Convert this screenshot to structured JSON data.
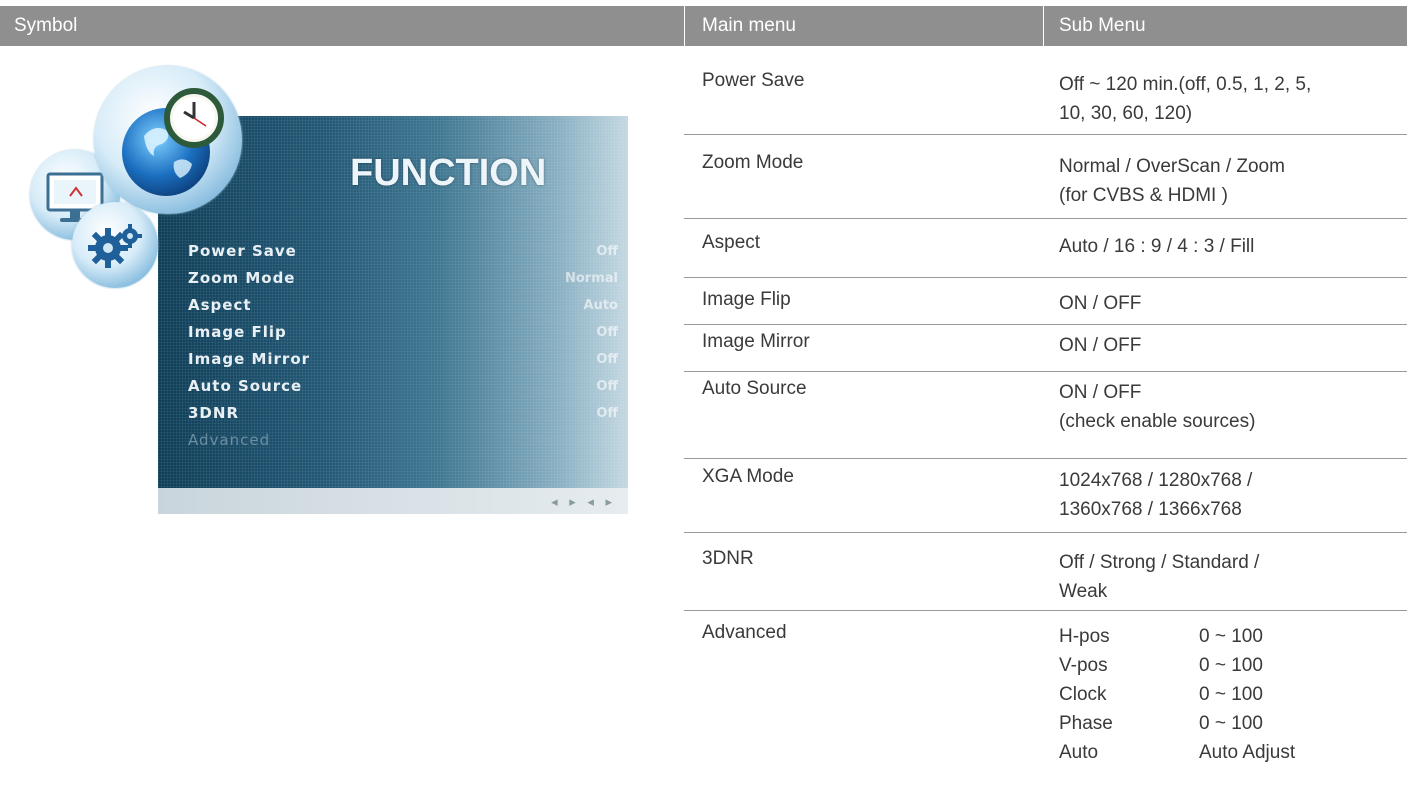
{
  "headers": {
    "symbol": "Symbol",
    "main_menu": "Main menu",
    "sub_menu": "Sub Menu"
  },
  "osd": {
    "title": "FUNCTION",
    "items": [
      "Power Save",
      "Zoom Mode",
      "Aspect",
      "Image Flip",
      "Image Mirror",
      "Auto Source",
      "3DNR",
      "Advanced"
    ],
    "values": [
      "Off",
      "Normal",
      "Auto",
      "Off",
      "Off",
      "Off",
      "Off"
    ]
  },
  "rows": [
    {
      "main": "Power Save",
      "sub": [
        "Off ~ 120 min.(off, 0.5, 1, 2, 5,",
        "10, 30, 60, 120)"
      ]
    },
    {
      "main": "Zoom Mode",
      "sub": [
        "Normal / OverScan / Zoom",
        "(for CVBS & HDMI )"
      ]
    },
    {
      "main": "Aspect",
      "sub": [
        "Auto / 16 : 9 / 4 : 3 / Fill"
      ]
    },
    {
      "main": "Image Flip",
      "sub": [
        "ON / OFF"
      ]
    },
    {
      "main": "Image Mirror",
      "sub": [
        "ON / OFF"
      ]
    },
    {
      "main": "Auto Source",
      "sub": [
        "ON / OFF",
        "(check enable sources)"
      ]
    },
    {
      "main": "XGA Mode",
      "sub": [
        "1024x768 / 1280x768 /",
        "1360x768 / 1366x768"
      ]
    },
    {
      "main": "3DNR",
      "sub": [
        "Off / Strong / Standard /",
        "Weak"
      ]
    }
  ],
  "advanced": {
    "main": "Advanced",
    "items": [
      {
        "name": "H-pos",
        "range": "0 ~ 100"
      },
      {
        "name": "V-pos",
        "range": "0 ~ 100"
      },
      {
        "name": "Clock",
        "range": "0 ~ 100"
      },
      {
        "name": "Phase",
        "range": "0 ~ 100"
      },
      {
        "name": "Auto",
        "range": "Auto Adjust"
      }
    ]
  }
}
